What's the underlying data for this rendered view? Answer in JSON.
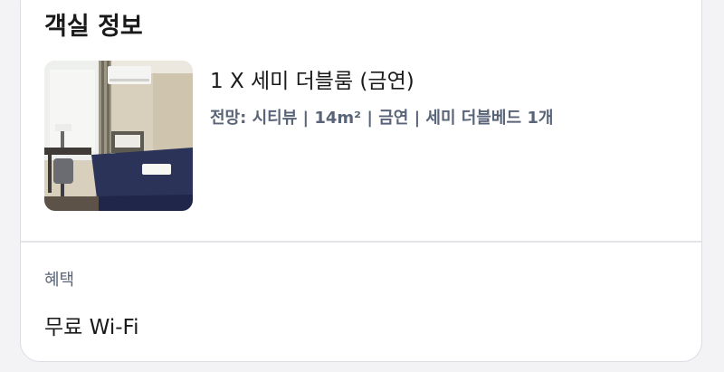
{
  "room_info": {
    "section_title": "객실 정보",
    "room_name": "1 X 세미 더블룸 (금연)",
    "details": {
      "view": "전망: 시티뷰",
      "sep1": " | ",
      "size": "14m²",
      "sep2": " | ",
      "smoking": "금연",
      "sep3": " | ",
      "bed": "세미 더블베드 1개"
    },
    "photo_alt": "room-photo"
  },
  "benefits": {
    "label": "혜택",
    "items": [
      "무료 Wi-Fi"
    ]
  },
  "colors": {
    "title_text": "#1a1a1a",
    "secondary_text": "#5a6478",
    "card_bg": "#ffffff",
    "page_bg": "#f3f3f5",
    "divider": "#e3e4e8"
  }
}
